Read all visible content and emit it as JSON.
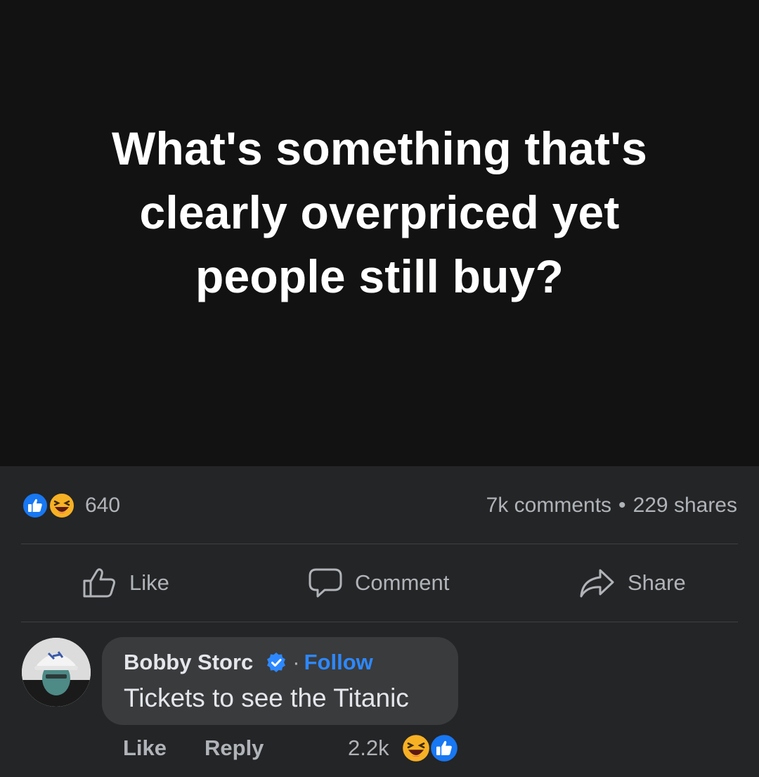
{
  "post": {
    "text": "What's something that's clearly overpriced yet people still buy?"
  },
  "summary": {
    "reaction_icons": [
      "like-icon",
      "haha-icon"
    ],
    "reaction_count": "640",
    "comments": "7k comments",
    "separator": "•",
    "shares": "229 shares"
  },
  "actions": {
    "like": "Like",
    "comment": "Comment",
    "share": "Share"
  },
  "comment": {
    "author": "Bobby Storc",
    "separator": "·",
    "follow": "Follow",
    "text": "Tickets to see the Titanic",
    "like": "Like",
    "reply": "Reply",
    "reaction_count": "2.2k",
    "reaction_icons": [
      "haha-icon",
      "like-icon"
    ]
  },
  "colors": {
    "background": "#242526",
    "post_background": "#121213",
    "accent": "#2d88ff",
    "secondary_text": "#b0b3b8",
    "bubble": "#3a3b3c"
  }
}
